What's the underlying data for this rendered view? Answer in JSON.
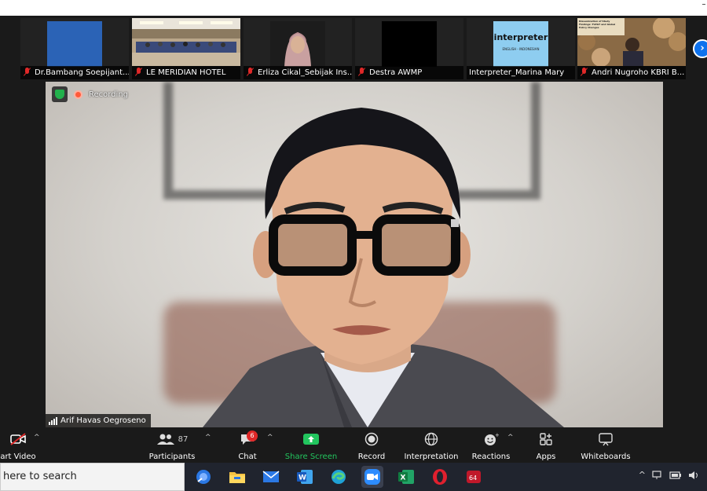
{
  "gallery": {
    "tiles": [
      {
        "name": "Dr.Bambang Soepijant...",
        "muted": true
      },
      {
        "name": "LE MERIDIAN HOTEL",
        "muted": true
      },
      {
        "name": "Erliza Cikal_Sebijak Ins...",
        "muted": true
      },
      {
        "name": "Destra AWMP",
        "muted": true
      },
      {
        "name": "Interpreter_Marina Mary",
        "muted": false
      },
      {
        "name": "Andri Nugroho KBRI B...",
        "muted": true
      }
    ],
    "interpreter_card": {
      "title": "interpreter",
      "subtitle": "ENGLISH - INDONESIAN"
    },
    "slide_text": "Dissemination of Study Findings: FLEGT and Global Policy Changes",
    "next_icon": "chevron-right-icon"
  },
  "main": {
    "recording_label": "Recording",
    "speaker_name": "Arif Havas Oegroseno"
  },
  "toolbar": {
    "video_label": "art Video",
    "participants_label": "Participants",
    "participants_count": "87",
    "chat_label": "Chat",
    "chat_badge": "6",
    "share_label": "Share Screen",
    "record_label": "Record",
    "interpretation_label": "Interpretation",
    "reactions_label": "Reactions",
    "apps_label": "Apps",
    "whiteboards_label": "Whiteboards",
    "caret": "^",
    "share_color": "#22c55e"
  },
  "taskbar": {
    "search_text": "here to search",
    "opera_badge": "64"
  }
}
